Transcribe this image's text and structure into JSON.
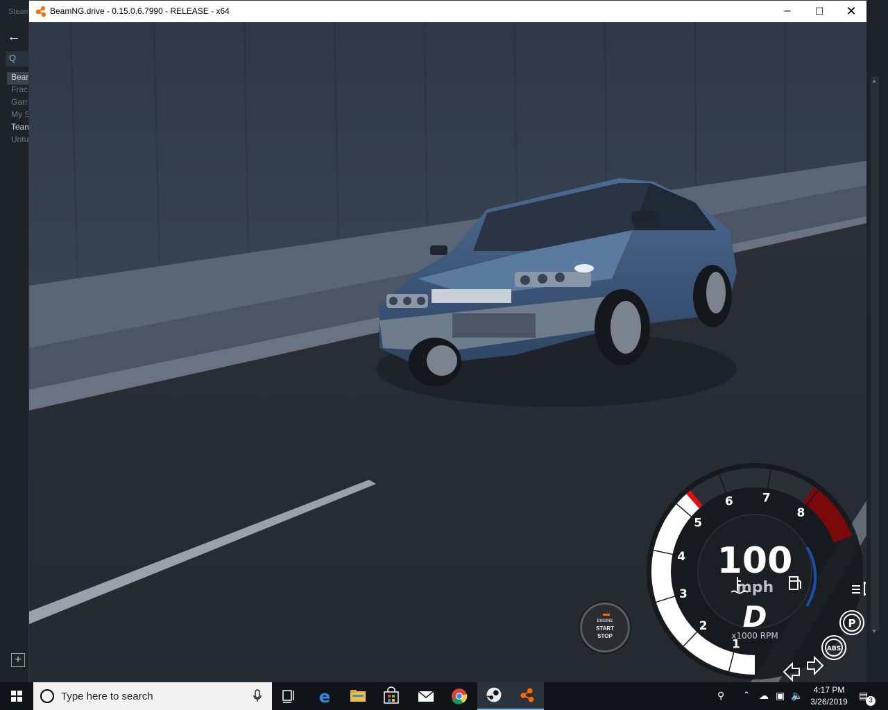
{
  "steam": {
    "title": "Steam",
    "search_glyph": "Q",
    "items": [
      "Beam",
      "Frac",
      "Garr",
      "My S",
      "Team",
      "Untu"
    ],
    "add_icon": "plus-icon"
  },
  "window": {
    "title": "BeamNG.drive - 0.15.0.6.7990 - RELEASE - x64",
    "minimize": "–",
    "maximize": "☐",
    "close": "✕"
  },
  "engine_button": {
    "label_top": "ENGINE",
    "label_start": "START",
    "label_stop": "STOP",
    "led_color": "#ff6a00"
  },
  "gauge": {
    "speed": "100",
    "unit": "mph",
    "gear": "D",
    "rpm_label": "x1000 RPM",
    "rpm_ticks": [
      "1",
      "2",
      "3",
      "4",
      "5",
      "6",
      "7",
      "8"
    ],
    "redline_color": "#7a0a0a",
    "rpm_fill_fraction": 0.56,
    "icons": [
      "coolant-temp-icon",
      "fuel-icon",
      "headlight-icon",
      "parking-brake-icon",
      "abs-icon",
      "left-turn-signal-icon",
      "right-turn-signal-icon"
    ],
    "parking_label": "P",
    "abs_label": "ABS"
  },
  "taskbar": {
    "search_placeholder": "Type here to search",
    "time": "4:17 PM",
    "date": "3/26/2019",
    "notification_count": "3"
  }
}
